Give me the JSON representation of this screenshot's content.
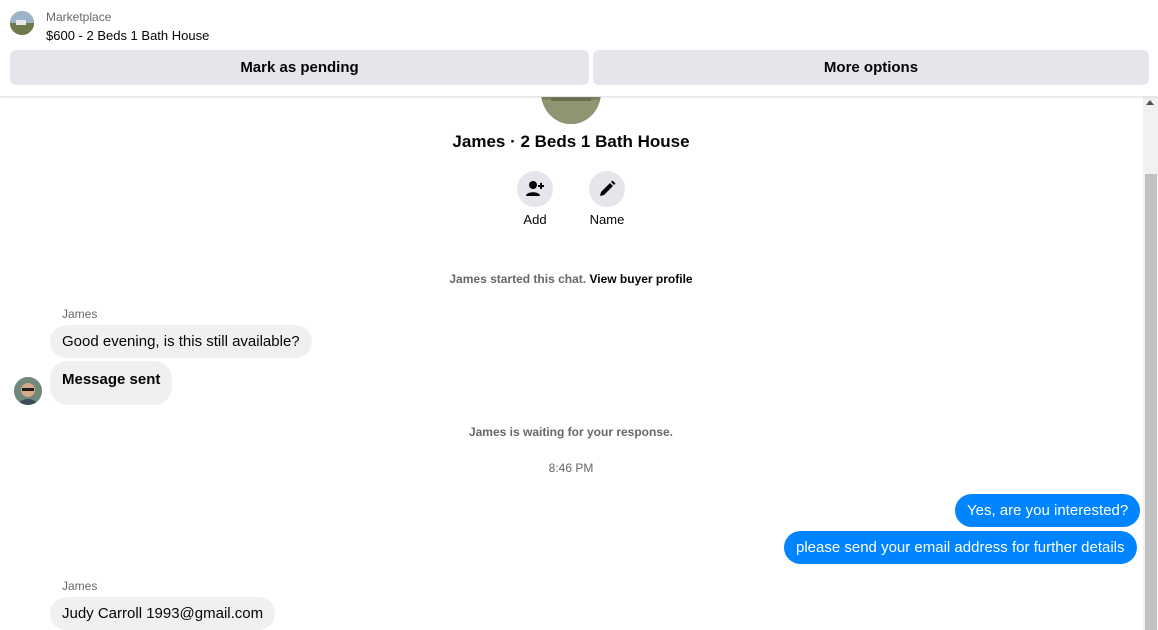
{
  "header": {
    "subtitle": "Marketplace",
    "title": "$600 - 2 Beds 1 Bath House",
    "buttons": {
      "pending": "Mark as pending",
      "more": "More options"
    }
  },
  "conversation": {
    "title": "James · 2 Beds 1 Bath House",
    "actions": {
      "add": "Add",
      "name": "Name"
    },
    "started": {
      "text": "James started this chat.",
      "link": "View buyer profile"
    },
    "waiting": "James is waiting for your response.",
    "time": "8:46 PM"
  },
  "messages": {
    "group1_sender": "James",
    "m1": "Good evening, is this still available?",
    "m2": "Message sent",
    "out1": "Yes, are you interested?",
    "out2": "please send your email address for further details",
    "group2_sender": "James",
    "m3": "Judy Carroll 1993@gmail.com"
  },
  "colors": {
    "accent": "#0084ff",
    "button_bg": "#e4e6eb",
    "bubble_in": "#f0f0f0"
  }
}
